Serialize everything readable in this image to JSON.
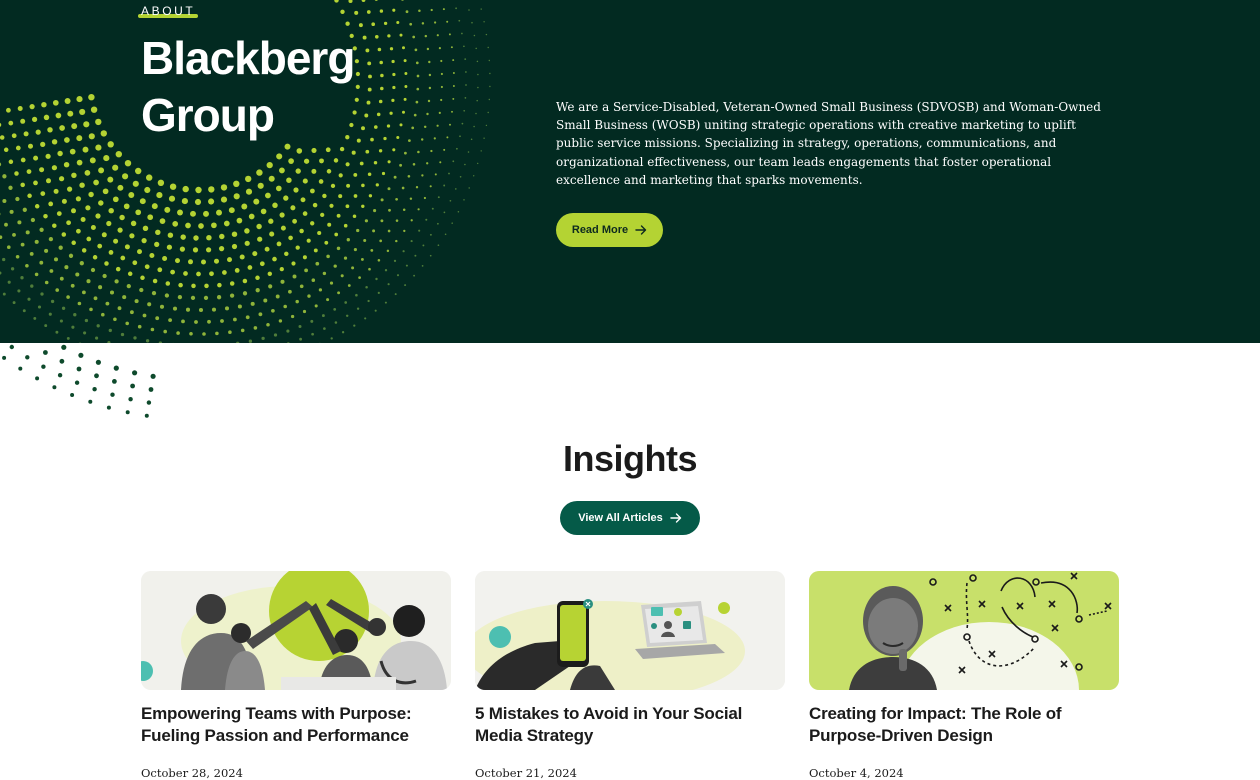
{
  "about": {
    "eyebrow": "ABOUT",
    "title": "Blackberg Group",
    "description": "We are a Service-Disabled, Veteran-Owned Small Business (SDVOSB) and Woman-Owned Small Business (WOSB) uniting strategic operations with creative marketing to uplift public service missions. Specializing in strategy, operations, communications, and organizational effectiveness, our team leads engagements that foster operational excellence and marketing that sparks movements.",
    "read_more_label": "Read More",
    "read_more_icon": "arrow-right-icon"
  },
  "insights": {
    "title": "Insights",
    "view_all_label": "View All Articles",
    "view_all_icon": "arrow-right-icon",
    "articles": [
      {
        "title": "Empowering Teams with Purpose: Fueling Passion and Performance",
        "date": "October 28, 2024"
      },
      {
        "title": "5 Mistakes to Avoid in Your Social Media Strategy",
        "date": "October 21, 2024"
      },
      {
        "title": "Creating for Impact: The Role of Purpose-Driven Design",
        "date": "October 4, 2024"
      }
    ]
  },
  "colors": {
    "hero_bg": "#022a21",
    "accent_lime": "#b4d333",
    "button_green": "#055a48",
    "dot_dark": "#0e4a2c",
    "text_dark": "#1b1b1b"
  }
}
